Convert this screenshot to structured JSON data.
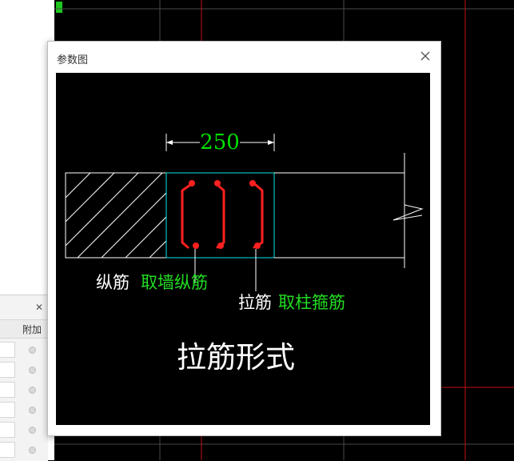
{
  "dialog": {
    "title": "参数图"
  },
  "diagram": {
    "dimension": "250",
    "label_longitudinal": "纵筋",
    "label_longitudinal_source": "取墙纵筋",
    "label_tie": "拉筋",
    "label_tie_source": "取柱箍筋",
    "caption": "拉筋形式"
  },
  "subpanel": {
    "column_header": "附加"
  },
  "colors": {
    "dimension": "#00e000",
    "source_text": "#22dd22",
    "outline": "#00e5e5",
    "rebar": "#ff2020",
    "white": "#ffffff",
    "cad_red_line": "#c81010",
    "cad_grid_line": "#4a4a4a"
  }
}
